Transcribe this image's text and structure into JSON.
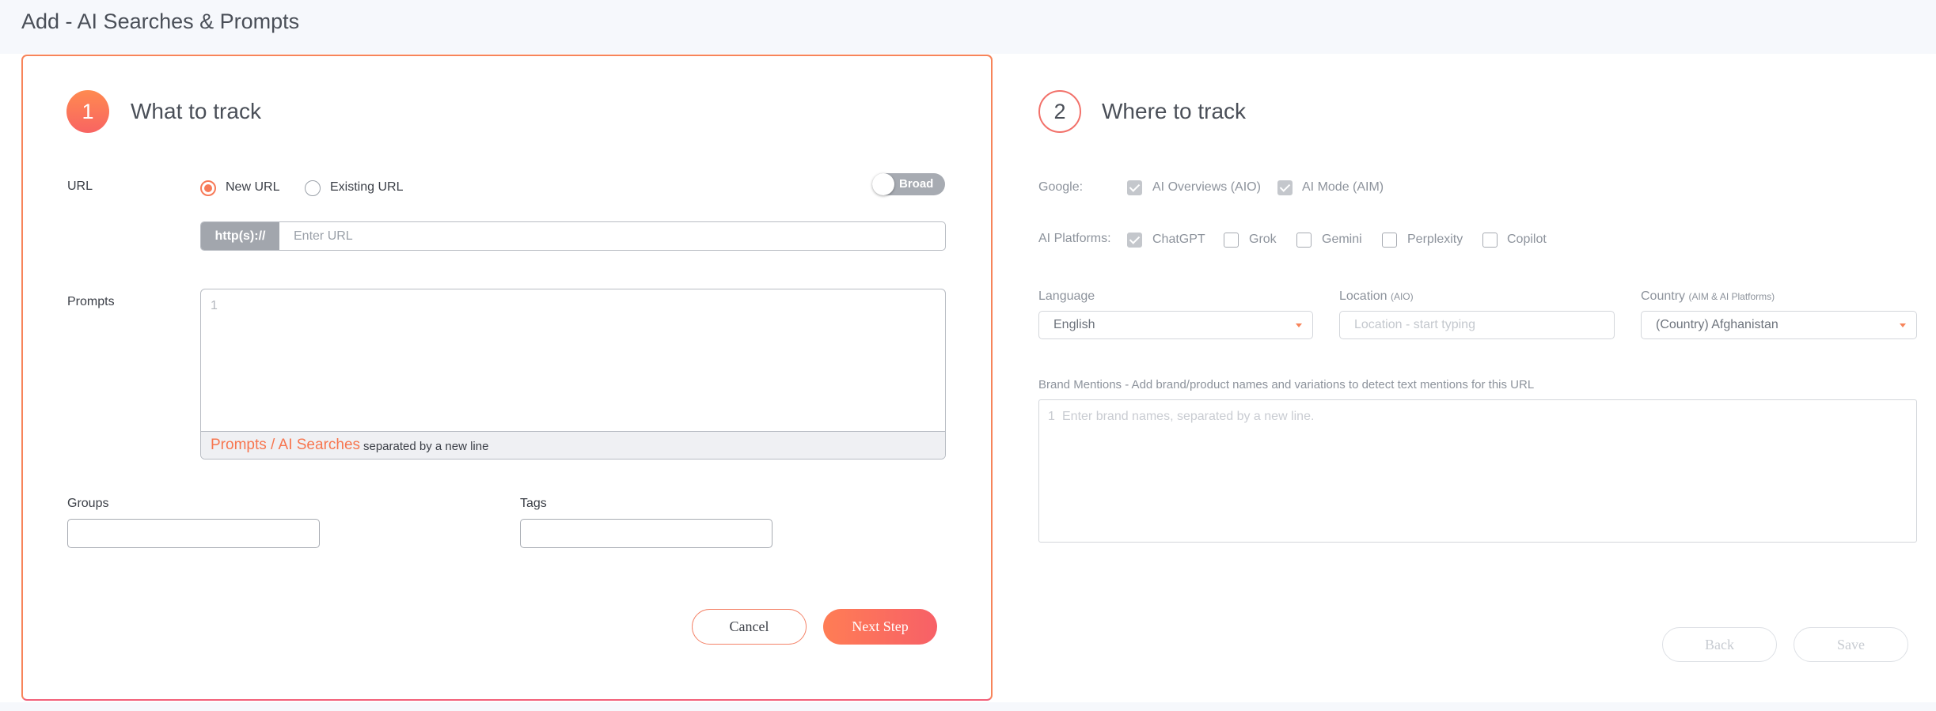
{
  "page": {
    "title": "Add - AI Searches & Prompts"
  },
  "step1": {
    "number": "1",
    "title": "What to track",
    "url": {
      "label": "URL",
      "new_url_label": "New URL",
      "existing_url_label": "Existing URL",
      "selected": "New URL",
      "toggle_label": "Broad",
      "prefix": "http(s)://",
      "placeholder": "Enter URL",
      "value": ""
    },
    "prompts": {
      "label": "Prompts",
      "line_number": "1",
      "footer_accent": "Prompts / AI Searches",
      "footer_hint": "separated by a new line"
    },
    "groups_label": "Groups",
    "tags_label": "Tags",
    "cancel_label": "Cancel",
    "next_label": "Next Step"
  },
  "step2": {
    "number": "2",
    "title": "Where to track",
    "google": {
      "label": "Google:",
      "options": [
        {
          "label": "AI Overviews (AIO)",
          "checked": true
        },
        {
          "label": "AI Mode (AIM)",
          "checked": true
        }
      ]
    },
    "ai_platforms": {
      "label": "AI Platforms:",
      "options": [
        {
          "label": "ChatGPT",
          "checked": true
        },
        {
          "label": "Grok",
          "checked": false
        },
        {
          "label": "Gemini",
          "checked": false
        },
        {
          "label": "Perplexity",
          "checked": false
        },
        {
          "label": "Copilot",
          "checked": false
        }
      ]
    },
    "language": {
      "label": "Language",
      "value": "English"
    },
    "location": {
      "label": "Location",
      "sublabel": "(AIO)",
      "placeholder": "Location - start typing"
    },
    "country": {
      "label": "Country",
      "sublabel": "(AIM & AI Platforms)",
      "value": "(Country) Afghanistan"
    },
    "brand": {
      "label": "Brand Mentions - Add brand/product names and variations to detect text mentions for this URL",
      "line_number": "1",
      "placeholder": "Enter brand names, separated by a new line."
    },
    "back_label": "Back",
    "save_label": "Save"
  },
  "colors": {
    "accent": "#f7845a",
    "accent_gradient_end": "#f76067",
    "muted": "#a7abb2"
  }
}
